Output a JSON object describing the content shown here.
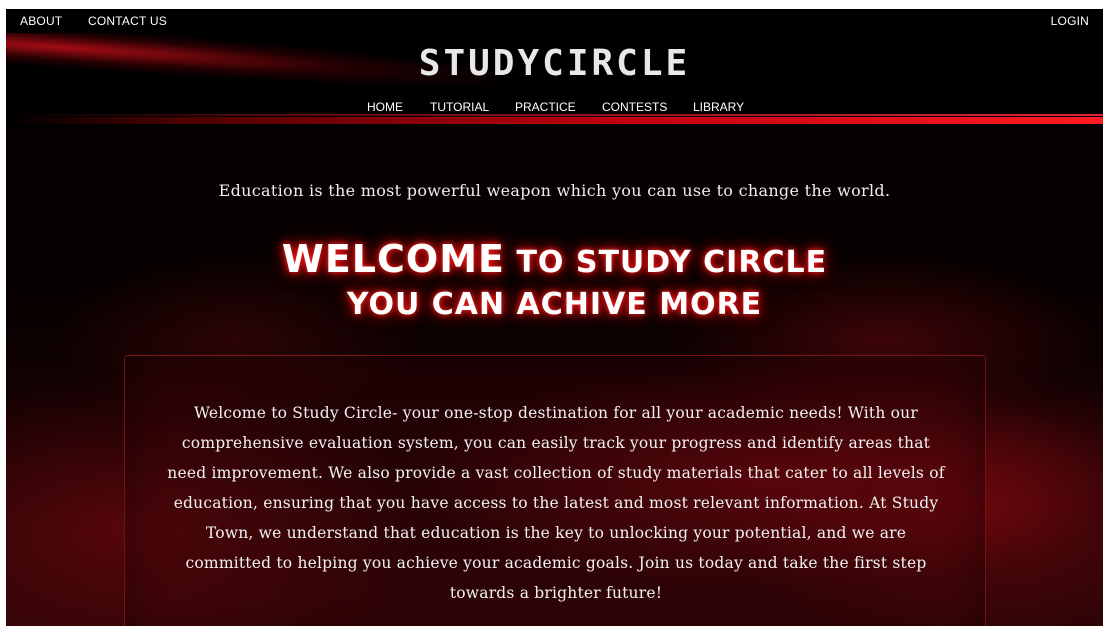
{
  "topnav": {
    "about": "ABOUT",
    "contact": "CONTACT US",
    "login": "LOGIN"
  },
  "header": {
    "brand": "STUDYCIRCLE",
    "nav": [
      "HOME",
      "TUTORIAL",
      "PRACTICE",
      "CONTESTS",
      "LIBRARY"
    ]
  },
  "hero": {
    "quote": "Education is the most powerful weapon which you can use to change the world.",
    "welcome_word": "Welcome",
    "welcome_rest": "to study circle",
    "tagline": "you can achive more"
  },
  "about": {
    "text": "Welcome to Study Circle- your one-stop destination for all your academic needs! With our comprehensive evaluation system, you can easily track your progress and identify areas that need improvement. We also provide a vast collection of study materials that cater to all levels of education, ensuring that you have access to the latest and most relevant information. At Study Town, we understand that education is the key to unlocking your potential, and we are committed to helping you achieve your academic goals. Join us today and take the first step towards a brighter future!"
  },
  "colors": {
    "accent": "#ff1a22",
    "background": "#000000",
    "text": "#ffffff"
  }
}
